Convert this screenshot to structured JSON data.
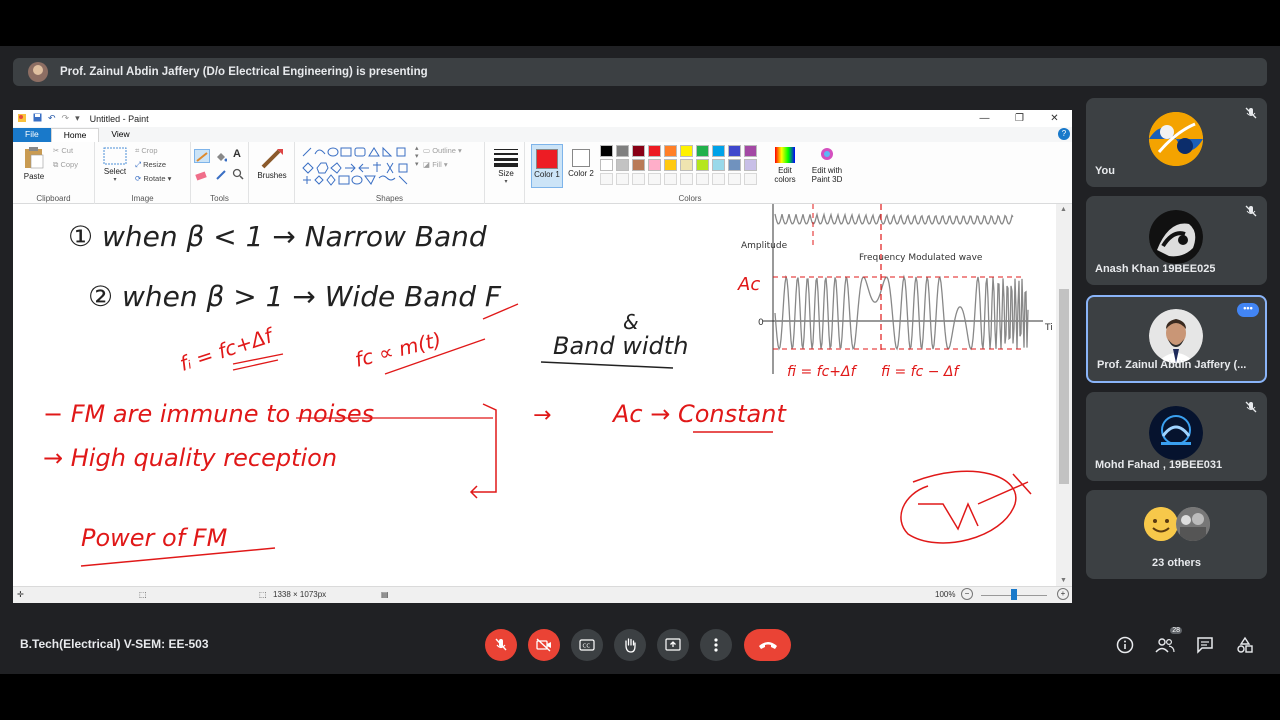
{
  "presentation": {
    "banner": "Prof. Zainul Abdin Jaffery (D/o Electrical Engineering) is presenting"
  },
  "paint": {
    "title": "Untitled - Paint",
    "tabs": {
      "file": "File",
      "home": "Home",
      "view": "View"
    },
    "ribbon": {
      "clipboard": {
        "label": "Clipboard",
        "paste": "Paste",
        "cut": "Cut",
        "copy": "Copy"
      },
      "image": {
        "label": "Image",
        "select": "Select",
        "crop": "Crop",
        "resize": "Resize",
        "rotate": "Rotate"
      },
      "tools": {
        "label": "Tools"
      },
      "brushes": "Brushes",
      "shapes": {
        "label": "Shapes",
        "outline": "Outline",
        "fill": "Fill"
      },
      "size": "Size",
      "colors": {
        "label": "Colors",
        "color1": "Color 1",
        "color2": "Color 2",
        "edit": "Edit colors",
        "edit3d": "Edit with Paint 3D",
        "color1_value": "#ed1c24",
        "color2_value": "#ffffff"
      }
    },
    "palette": [
      "#000000",
      "#7f7f7f",
      "#880015",
      "#ed1c24",
      "#ff7f27",
      "#fff200",
      "#22b14c",
      "#00a2e8",
      "#3f48cc",
      "#a349a4",
      "#ffffff",
      "#c3c3c3",
      "#b97a57",
      "#ffaec9",
      "#ffc90e",
      "#efe4b0",
      "#b5e61d",
      "#99d9ea",
      "#7092be",
      "#c8bfe7"
    ],
    "status": {
      "dimensions": "1338 × 1073px",
      "zoom": "100%"
    },
    "drawing": {
      "line1": "① when   β < 1  →  Narrow Band",
      "line2": "② when   β > 1  →  Wide Band F",
      "amp": "&",
      "bandwidth": "Band width",
      "fi": "fᵢ = fc+Δf",
      "fcprop": "fc ∝ m(t)",
      "fm_immune": "−  FM are immune to noises",
      "arrow_ac": "→",
      "ac_const": "Ac → Constant",
      "hq": "→  High quality reception",
      "power": "Power of FM",
      "graph_amplitude": "Amplitude",
      "graph_title": "Frequency Modulated wave",
      "graph_ac": "Ac",
      "graph_zero": "0",
      "graph_t": "Ti",
      "graph_fi1": "fi = fc+Δf",
      "graph_fi2": "fi = fc − Δf"
    }
  },
  "participants": [
    {
      "name": "You"
    },
    {
      "name": "Anash Khan 19BEE025"
    },
    {
      "name": "Prof. Zainul Abdin Jaffery (..."
    },
    {
      "name": "Mohd Fahad , 19BEE031"
    },
    {
      "name": "23 others"
    }
  ],
  "meeting": {
    "name": "B.Tech(Electrical) V-SEM: EE-503",
    "people_count": "28"
  }
}
